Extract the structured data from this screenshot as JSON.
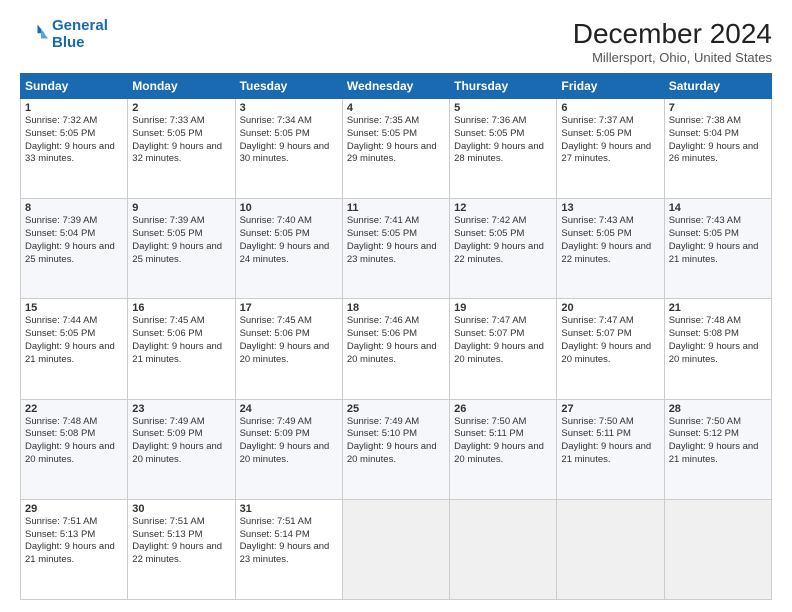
{
  "header": {
    "logo_line1": "General",
    "logo_line2": "Blue",
    "title": "December 2024",
    "subtitle": "Millersport, Ohio, United States"
  },
  "weekdays": [
    "Sunday",
    "Monday",
    "Tuesday",
    "Wednesday",
    "Thursday",
    "Friday",
    "Saturday"
  ],
  "weeks": [
    [
      {
        "day": "1",
        "sunrise": "7:32 AM",
        "sunset": "5:05 PM",
        "daylight": "9 hours and 33 minutes."
      },
      {
        "day": "2",
        "sunrise": "7:33 AM",
        "sunset": "5:05 PM",
        "daylight": "9 hours and 32 minutes."
      },
      {
        "day": "3",
        "sunrise": "7:34 AM",
        "sunset": "5:05 PM",
        "daylight": "9 hours and 30 minutes."
      },
      {
        "day": "4",
        "sunrise": "7:35 AM",
        "sunset": "5:05 PM",
        "daylight": "9 hours and 29 minutes."
      },
      {
        "day": "5",
        "sunrise": "7:36 AM",
        "sunset": "5:05 PM",
        "daylight": "9 hours and 28 minutes."
      },
      {
        "day": "6",
        "sunrise": "7:37 AM",
        "sunset": "5:05 PM",
        "daylight": "9 hours and 27 minutes."
      },
      {
        "day": "7",
        "sunrise": "7:38 AM",
        "sunset": "5:04 PM",
        "daylight": "9 hours and 26 minutes."
      }
    ],
    [
      {
        "day": "8",
        "sunrise": "7:39 AM",
        "sunset": "5:04 PM",
        "daylight": "9 hours and 25 minutes."
      },
      {
        "day": "9",
        "sunrise": "7:39 AM",
        "sunset": "5:05 PM",
        "daylight": "9 hours and 25 minutes."
      },
      {
        "day": "10",
        "sunrise": "7:40 AM",
        "sunset": "5:05 PM",
        "daylight": "9 hours and 24 minutes."
      },
      {
        "day": "11",
        "sunrise": "7:41 AM",
        "sunset": "5:05 PM",
        "daylight": "9 hours and 23 minutes."
      },
      {
        "day": "12",
        "sunrise": "7:42 AM",
        "sunset": "5:05 PM",
        "daylight": "9 hours and 22 minutes."
      },
      {
        "day": "13",
        "sunrise": "7:43 AM",
        "sunset": "5:05 PM",
        "daylight": "9 hours and 22 minutes."
      },
      {
        "day": "14",
        "sunrise": "7:43 AM",
        "sunset": "5:05 PM",
        "daylight": "9 hours and 21 minutes."
      }
    ],
    [
      {
        "day": "15",
        "sunrise": "7:44 AM",
        "sunset": "5:05 PM",
        "daylight": "9 hours and 21 minutes."
      },
      {
        "day": "16",
        "sunrise": "7:45 AM",
        "sunset": "5:06 PM",
        "daylight": "9 hours and 21 minutes."
      },
      {
        "day": "17",
        "sunrise": "7:45 AM",
        "sunset": "5:06 PM",
        "daylight": "9 hours and 20 minutes."
      },
      {
        "day": "18",
        "sunrise": "7:46 AM",
        "sunset": "5:06 PM",
        "daylight": "9 hours and 20 minutes."
      },
      {
        "day": "19",
        "sunrise": "7:47 AM",
        "sunset": "5:07 PM",
        "daylight": "9 hours and 20 minutes."
      },
      {
        "day": "20",
        "sunrise": "7:47 AM",
        "sunset": "5:07 PM",
        "daylight": "9 hours and 20 minutes."
      },
      {
        "day": "21",
        "sunrise": "7:48 AM",
        "sunset": "5:08 PM",
        "daylight": "9 hours and 20 minutes."
      }
    ],
    [
      {
        "day": "22",
        "sunrise": "7:48 AM",
        "sunset": "5:08 PM",
        "daylight": "9 hours and 20 minutes."
      },
      {
        "day": "23",
        "sunrise": "7:49 AM",
        "sunset": "5:09 PM",
        "daylight": "9 hours and 20 minutes."
      },
      {
        "day": "24",
        "sunrise": "7:49 AM",
        "sunset": "5:09 PM",
        "daylight": "9 hours and 20 minutes."
      },
      {
        "day": "25",
        "sunrise": "7:49 AM",
        "sunset": "5:10 PM",
        "daylight": "9 hours and 20 minutes."
      },
      {
        "day": "26",
        "sunrise": "7:50 AM",
        "sunset": "5:11 PM",
        "daylight": "9 hours and 20 minutes."
      },
      {
        "day": "27",
        "sunrise": "7:50 AM",
        "sunset": "5:11 PM",
        "daylight": "9 hours and 21 minutes."
      },
      {
        "day": "28",
        "sunrise": "7:50 AM",
        "sunset": "5:12 PM",
        "daylight": "9 hours and 21 minutes."
      }
    ],
    [
      {
        "day": "29",
        "sunrise": "7:51 AM",
        "sunset": "5:13 PM",
        "daylight": "9 hours and 21 minutes."
      },
      {
        "day": "30",
        "sunrise": "7:51 AM",
        "sunset": "5:13 PM",
        "daylight": "9 hours and 22 minutes."
      },
      {
        "day": "31",
        "sunrise": "7:51 AM",
        "sunset": "5:14 PM",
        "daylight": "9 hours and 23 minutes."
      },
      null,
      null,
      null,
      null
    ]
  ]
}
